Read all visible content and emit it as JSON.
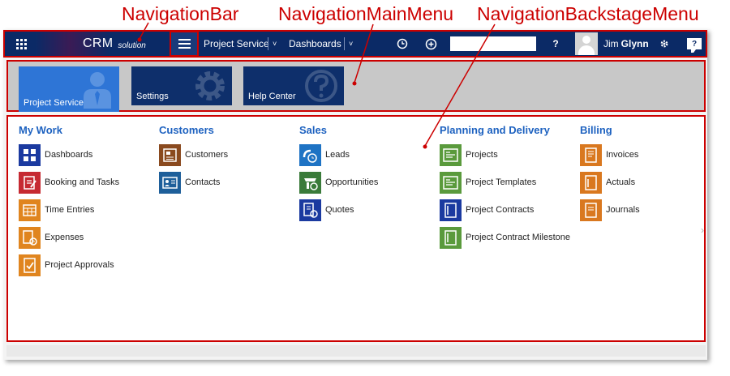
{
  "annotations": {
    "navigation_bar": "NavigationBar",
    "navigation_main_menu": "NavigationMainMenu",
    "navigation_backstage_menu": "NavigationBackstageMenu"
  },
  "navbar": {
    "brand": "CRM",
    "brand_suffix": "solution",
    "module_label": "Project Service",
    "area_label": "Dashboards",
    "chevron": "˅",
    "help": "?",
    "user_first": "Jim",
    "user_last": "Glynn",
    "feedback": "?",
    "search_value": ""
  },
  "main_menu": {
    "tiles": [
      {
        "label": "Project Service",
        "icon": "person-icon"
      },
      {
        "label": "Settings",
        "icon": "gear-icon"
      },
      {
        "label": "Help Center",
        "icon": "question-icon"
      }
    ]
  },
  "backstage": {
    "groups": [
      {
        "title": "My Work",
        "items": [
          {
            "label": "Dashboards",
            "color": "#1b3aa0",
            "icon": "dashboard-icon"
          },
          {
            "label": "Booking and Tasks",
            "color": "#c62a32",
            "icon": "booking-icon"
          },
          {
            "label": "Time Entries",
            "color": "#e0851f",
            "icon": "calendar-icon"
          },
          {
            "label": "Expenses",
            "color": "#e0851f",
            "icon": "expense-icon"
          },
          {
            "label": "Project Approvals",
            "color": "#e0851f",
            "icon": "approval-icon"
          }
        ]
      },
      {
        "title": "Customers",
        "items": [
          {
            "label": "Customers",
            "color": "#8a4a1f",
            "icon": "customer-icon"
          },
          {
            "label": "Contacts",
            "color": "#1e5f9a",
            "icon": "contact-card-icon"
          }
        ]
      },
      {
        "title": "Sales",
        "items": [
          {
            "label": "Leads",
            "color": "#1e73c4",
            "icon": "lead-icon"
          },
          {
            "label": "Opportunities",
            "color": "#3a7b3a",
            "icon": "opportunity-icon"
          },
          {
            "label": "Quotes",
            "color": "#1b3aa0",
            "icon": "quote-icon"
          }
        ]
      },
      {
        "title": "Planning and Delivery",
        "items": [
          {
            "label": "Projects",
            "color": "#5a9a3c",
            "icon": "project-icon"
          },
          {
            "label": "Project Templates",
            "color": "#5a9a3c",
            "icon": "template-icon"
          },
          {
            "label": "Project Contracts",
            "color": "#1b3aa0",
            "icon": "contract-icon"
          },
          {
            "label": "Project Contract Milestone",
            "color": "#5a9a3c",
            "icon": "milestone-icon"
          }
        ]
      },
      {
        "title": "Billing",
        "items": [
          {
            "label": "Invoices",
            "color": "#d9781f",
            "icon": "invoice-icon"
          },
          {
            "label": "Actuals",
            "color": "#d9781f",
            "icon": "actuals-icon"
          },
          {
            "label": "Journals",
            "color": "#d9781f",
            "icon": "journal-icon"
          }
        ]
      }
    ]
  }
}
